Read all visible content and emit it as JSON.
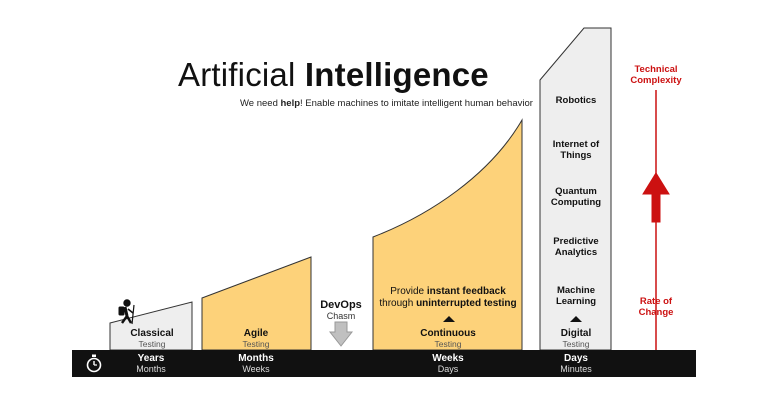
{
  "title": {
    "light": "Artificial",
    "bold": "Intelligence"
  },
  "subtitle": {
    "pre": "We need ",
    "bold": "help",
    "post": "! Enable machines to imitate intelligent human behavior"
  },
  "stages": [
    {
      "title": "Classical",
      "sub": "Testing"
    },
    {
      "title": "Agile",
      "sub": "Testing"
    },
    {
      "title": "Continuous",
      "sub": "Testing"
    },
    {
      "title": "Digital",
      "sub": "Testing"
    }
  ],
  "devops": {
    "title": "DevOps",
    "sub": "Chasm"
  },
  "feedback": {
    "pre1": "Provide ",
    "bold1": "instant feedback",
    "pre2": "through ",
    "bold2": "uninterrupted testing"
  },
  "digital_tiers": [
    "Robotics",
    "Internet of Things",
    "Quantum Computing",
    "Predictive Analytics",
    "Machine Learning"
  ],
  "timebar": [
    {
      "title": "Years",
      "sub": "Months"
    },
    {
      "title": "Months",
      "sub": "Weeks"
    },
    {
      "title": "Weeks",
      "sub": "Days"
    },
    {
      "title": "Days",
      "sub": "Minutes"
    }
  ],
  "right_axis": {
    "top": "Technical Complexity",
    "bottom": "Rate of Change"
  },
  "colors": {
    "yellow": "#fdd27a",
    "gray": "#eeeeee",
    "red": "#cc1111",
    "bar": "#111111"
  },
  "icons": [
    "stopwatch-icon",
    "hiker-icon",
    "arrow-down-icon",
    "arrow-up-icon",
    "triangle-up-icon"
  ]
}
